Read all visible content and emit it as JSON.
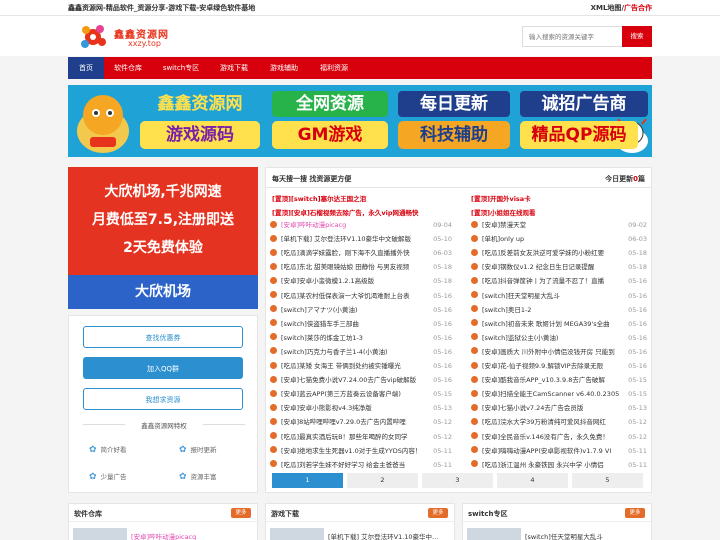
{
  "topbar": {
    "tagline": "鑫鑫资源网-精品软件_资源分享-游戏下载-安卓绿色软件基地",
    "xml_label": "XML地图",
    "sep": "/",
    "ad_label": "广告合作"
  },
  "header": {
    "logo_title": "鑫鑫资源网",
    "logo_sub": "xxzy.top",
    "search_placeholder": "输入搜索的资源关键字",
    "search_button": "搜索"
  },
  "nav": [
    "首页",
    "软件仓库",
    "switch专区",
    "游戏下载",
    "游戏辅助",
    "福利资源"
  ],
  "banner": {
    "top": [
      "鑫鑫资源网",
      "全网资源",
      "每日更新",
      "诚招广告商"
    ],
    "bottom": [
      "游戏源码",
      "GM游戏",
      "科技辅助",
      "精品QP源码"
    ]
  },
  "ad": {
    "lines": [
      "大欣机场,千兆网速",
      "月费低至7.5,注册即送",
      "2天免费体验"
    ],
    "bottom": "大欣机场"
  },
  "side": {
    "buttons": [
      "查找优惠券",
      "加入QQ群",
      "我想求资源"
    ],
    "feature_title": "鑫鑫资源网特权",
    "features": [
      "简介好看",
      "报时更新",
      "少量广告",
      "资源丰富"
    ]
  },
  "list": {
    "title": "每天搜一搜 找资源更方便",
    "today_prefix": "今日更新",
    "today_count": "0",
    "today_suffix": "篇",
    "pinned_left": [
      {
        "tag": "[置顶]",
        "text": "[switch]塞尔达王国之泪"
      },
      {
        "tag": "[置顶]",
        "text": "[安卓]石榴视频去除广告，永久vip网通畅快"
      }
    ],
    "pinned_right": [
      {
        "tag": "[置顶]",
        "text": "开国外visa卡"
      },
      {
        "tag": "[置顶]",
        "text": "小姐姐在线观看"
      }
    ],
    "left_rows": [
      {
        "name": "[安卓]哔咔动漫picacg",
        "date": "09-04",
        "pink": true
      },
      {
        "name": "[单机下载] 艾尔登法环V1.10豪华中文破解版",
        "date": "05-10"
      },
      {
        "name": "[吃瓜]滴滴学妹露脸，刚下海不久直播播外快",
        "date": "06-03"
      },
      {
        "name": "[吃瓜]东北 甜美眼镜姑娘 田静怡 与男友视频",
        "date": "05-18"
      },
      {
        "name": "[安卓]安卓小蛮微模1.2.1高级版",
        "date": "05-18"
      },
      {
        "name": "[吃瓜]某农村低保表演一大爷饥渴难耐上台表",
        "date": "05-16"
      },
      {
        "name": "[switch]アマナツ(小黄油)",
        "date": "05-16"
      },
      {
        "name": "[switch]侠盗猎车手三部曲",
        "date": "05-16"
      },
      {
        "name": "[switch]莱莎的炼金工坊1-3",
        "date": "05-16"
      },
      {
        "name": "[switch]巧克力与香子兰1-4(小黄油)",
        "date": "05-16"
      },
      {
        "name": "[吃瓜]某矮 女海王 带俩到处约被实锤曝光",
        "date": "05-16"
      },
      {
        "name": "[安卓]七猫免费小说V7.24.00去广告vip破解版",
        "date": "05-16"
      },
      {
        "name": "[安卓]蓝云APP(第三方蓝奏云设备客户端)",
        "date": "05-15"
      },
      {
        "name": "[安卓]安卓小熊影视v4.3纯净版",
        "date": "05-13"
      },
      {
        "name": "[安卓]8站哔哩哔哩v7.29.0去广告内置哔哩",
        "date": "05-12"
      },
      {
        "name": "[吃瓜]最真实酒后玩B！那些年喝醉的女同学",
        "date": "05-12"
      },
      {
        "name": "[安卓]绝地求生生死器v1.0对于生成YYDS内容！",
        "date": "05-11"
      },
      {
        "name": "[吃瓜]刘若学生妹不好好学习 给金主爸爸当",
        "date": "05-11"
      }
    ],
    "right_rows": [
      {
        "name": "[安卓]禁漫天堂",
        "date": "09-02"
      },
      {
        "name": "[单机]only up",
        "date": "06-03"
      },
      {
        "name": "[吃瓜]反差前女友洪逆可爱学妹的小粉红要",
        "date": "05-18"
      },
      {
        "name": "[安卓]钢数仪v1.2 纪念日生日记录提醒",
        "date": "05-18"
      },
      {
        "name": "[吃瓜]抖音弹筐钟丨为了流量不忍了！直播",
        "date": "05-16"
      },
      {
        "name": "[switch]狂天堂明星大乱斗",
        "date": "05-16"
      },
      {
        "name": "[switch]奥日1-2",
        "date": "05-16"
      },
      {
        "name": "[switch]初音未来 歌姬计划 MEGA39's全曲",
        "date": "05-16"
      },
      {
        "name": "[switch]监狱公主(小黄油)",
        "date": "05-16"
      },
      {
        "name": "[安卓]画质大 川外附中小情侣没钱开房 只能到",
        "date": "05-16"
      },
      {
        "name": "[安卓]花-仙子视频9.9.解锁VIP去除录无限",
        "date": "05-16"
      },
      {
        "name": "[安卓]酷我音乐APP_v10.3.9.8去广告破解",
        "date": "05-15"
      },
      {
        "name": "[安卓]扫描全能王CamScanner v6.40.0.2305",
        "date": "05-15"
      },
      {
        "name": "[安卓]七猫小说v7.24去广告会员版",
        "date": "05-13"
      },
      {
        "name": "[吃瓜]浣水大学39万粉清纯可爱风抖音网红",
        "date": "05-12"
      },
      {
        "name": "[安卓]全民音乐v.146没有广告，永久免费！",
        "date": "05-12"
      },
      {
        "name": "[安卓]嗨嗨动漫APP(安卓影视软件)v1.7.9 VI",
        "date": "05-11"
      },
      {
        "name": "[吃瓜]浙江温州 永豪铁园 永兴中学 小情侣",
        "date": "05-11"
      }
    ],
    "pages": [
      "1",
      "2",
      "3",
      "4",
      "5"
    ]
  },
  "bottom": [
    {
      "title": "软件仓库",
      "more": "更多",
      "item": "[安卓]哔咔动漫picacg"
    },
    {
      "title": "游戏下载",
      "more": "更多",
      "item": "[单机下载] 艾尔登法环V1.10豪华中..."
    },
    {
      "title": "switch专区",
      "more": "更多",
      "item": "[switch]任天堂明星大乱斗"
    }
  ],
  "colors": {
    "brand_red": "#d9000d",
    "nav_active": "#1f3f8c",
    "link_blue": "#2b8fd0",
    "banner_bg": "#1fa3d6",
    "dot_orange": "#e36c2a",
    "pink_text": "#e048b0"
  }
}
